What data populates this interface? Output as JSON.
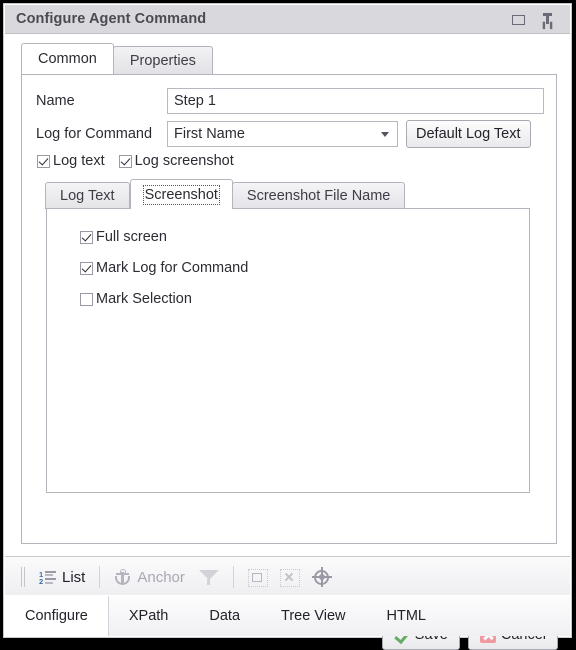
{
  "window": {
    "title": "Configure Agent Command",
    "controls": [
      {
        "name": "restore-button",
        "icon": "restore-icon"
      },
      {
        "name": "pin-button",
        "icon": "pin-icon"
      }
    ]
  },
  "outer_tabs": [
    {
      "label": "Common",
      "active": true
    },
    {
      "label": "Properties",
      "active": false
    }
  ],
  "form": {
    "name_label": "Name",
    "name_value": "Step 1",
    "name_placeholder": "",
    "log_label": "Log for Command",
    "log_value": "First Name",
    "default_log_text_button": "Default Log Text",
    "log_text_checkbox": {
      "label": "Log text",
      "checked": true
    },
    "log_screenshot_checkbox": {
      "label": "Log screenshot",
      "checked": true
    }
  },
  "inner_tabs": [
    {
      "label": "Log Text",
      "active": false
    },
    {
      "label": "Screenshot",
      "active": true
    },
    {
      "label": "Screenshot File Name",
      "active": false
    }
  ],
  "screenshot_options": [
    {
      "label": "Full screen",
      "checked": true
    },
    {
      "label": "Mark Log for Command",
      "checked": true
    },
    {
      "label": "Mark Selection",
      "checked": false
    }
  ],
  "actions": {
    "save_label": "Save",
    "cancel_label": "Cancel"
  },
  "toolbar": {
    "list_label": "List",
    "anchor_label": "Anchor",
    "icons": [
      "list-icon",
      "anchor-icon",
      "funnel-icon",
      "select-region-icon",
      "clear-selection-icon",
      "target-icon"
    ]
  },
  "bottom_tabs": [
    {
      "label": "Configure",
      "active": true
    },
    {
      "label": "XPath",
      "active": false
    },
    {
      "label": "Data",
      "active": false
    },
    {
      "label": "Tree View",
      "active": false
    },
    {
      "label": "HTML",
      "active": false
    }
  ],
  "colors": {
    "titlebar_bg": "#d9d9dd",
    "title_text": "#4a4a52",
    "accent_check": "#66aa66",
    "accent_cancel": "#ef9aa0",
    "list_number": "#3c6ea5"
  }
}
